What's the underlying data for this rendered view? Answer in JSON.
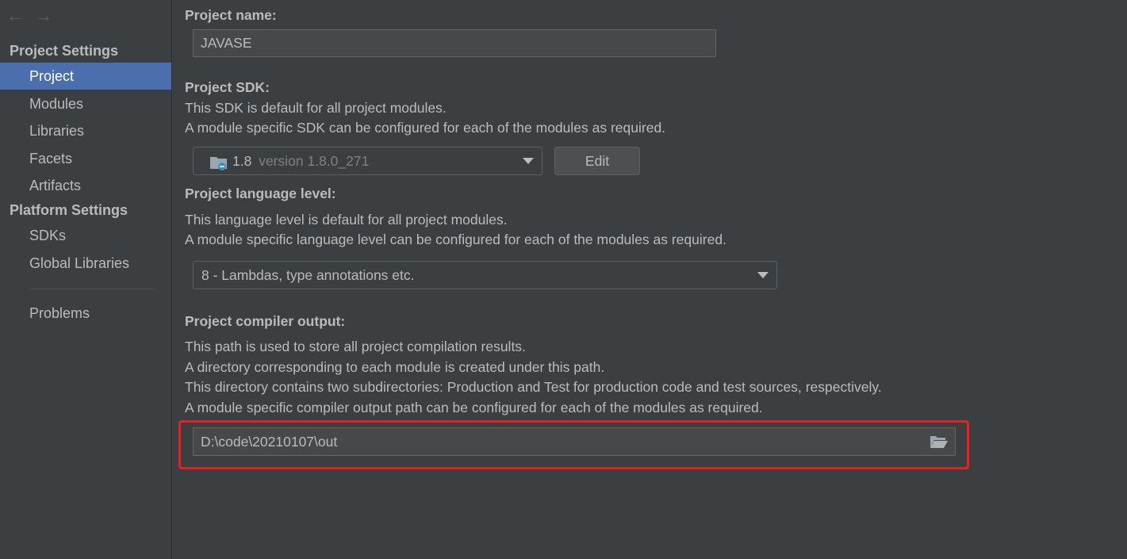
{
  "sidebar": {
    "back_arrow": "←",
    "forward_arrow": "→",
    "project_settings_header": "Project Settings",
    "project_settings_items": [
      "Project",
      "Modules",
      "Libraries",
      "Facets",
      "Artifacts"
    ],
    "platform_settings_header": "Platform Settings",
    "platform_settings_items": [
      "SDKs",
      "Global Libraries"
    ],
    "problems": "Problems",
    "selected": "Project"
  },
  "project_name": {
    "label": "Project name:",
    "value": "JAVASE"
  },
  "project_sdk": {
    "label": "Project SDK:",
    "desc_line1": "This SDK is default for all project modules.",
    "desc_line2": "A module specific SDK can be configured for each of the modules as required.",
    "selected_name": "1.8",
    "selected_version": "version 1.8.0_271",
    "icon": "folder-icon",
    "edit_button": "Edit"
  },
  "language_level": {
    "label": "Project language level:",
    "desc_line1": "This language level is default for all project modules.",
    "desc_line2": "A module specific language level can be configured for each of the modules as required.",
    "selected": "8 - Lambdas, type annotations etc."
  },
  "compiler_output": {
    "label": "Project compiler output:",
    "desc_line1": "This path is used to store all project compilation results.",
    "desc_line2": "A directory corresponding to each module is created under this path.",
    "desc_line3": "This directory contains two subdirectories: Production and Test for production code and test sources, respectively.",
    "desc_line4": "A module specific compiler output path can be configured for each of the modules as required.",
    "path": "D:\\code\\20210107\\out",
    "browse_icon": "folder-open-icon"
  },
  "colors": {
    "background": "#3c3f41",
    "selection": "#4b6eaf",
    "highlight_border": "#e8201f",
    "text": "#bbbbbb"
  }
}
